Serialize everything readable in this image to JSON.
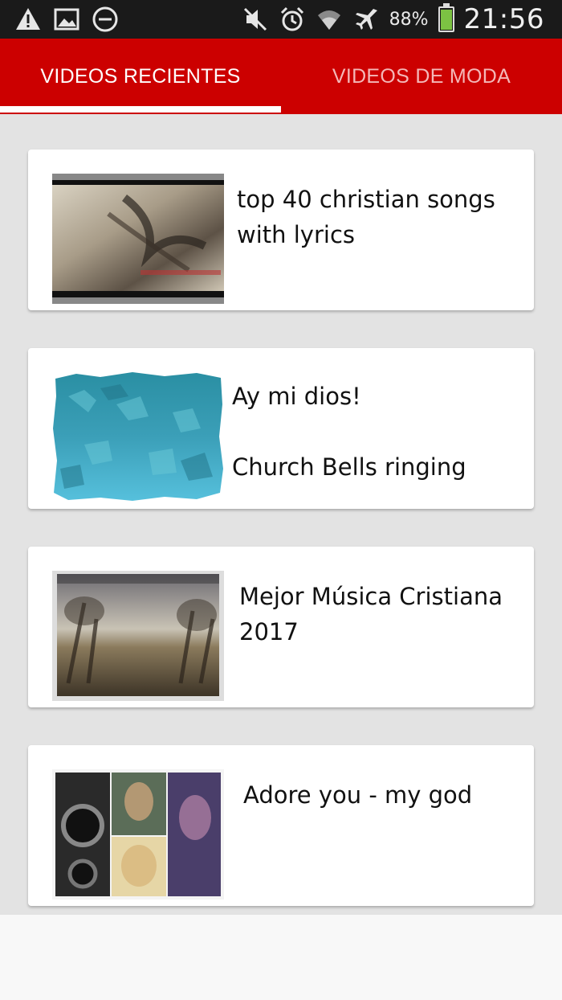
{
  "status_bar": {
    "left_icons": [
      "warning-icon",
      "image-icon",
      "do-not-disturb-icon"
    ],
    "right_icons": [
      "mute-icon",
      "alarm-icon",
      "wifi-icon",
      "airplane-mode-icon"
    ],
    "battery_percent": "88%",
    "battery_level": 0.88,
    "time": "21:56"
  },
  "tabs": [
    {
      "label": "VIDEOS RECIENTES",
      "selected": true
    },
    {
      "label": "VIDEOS DE MODA",
      "selected": false
    }
  ],
  "colors": {
    "accent": "#cc0000",
    "tab_selected_text": "#ffffff",
    "tab_unselected_text": "#f4b8b8",
    "list_background": "#e3e3e3"
  },
  "videos": [
    {
      "title": "top 40 christian songs with lyrics",
      "thumbnail": "video-thumbnail-1"
    },
    {
      "title": "Ay mi dios!\n\nChurch Bells ringing",
      "thumbnail": "video-thumbnail-2"
    },
    {
      "title": "Mejor Música Cristiana 2017",
      "thumbnail": "video-thumbnail-3"
    },
    {
      "title": "Adore you - my god",
      "thumbnail": "video-thumbnail-4"
    }
  ]
}
